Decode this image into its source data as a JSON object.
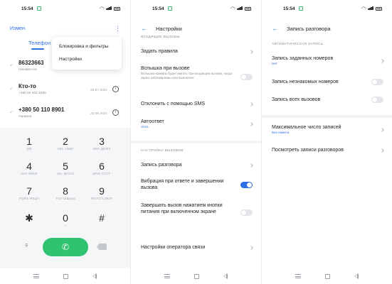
{
  "status": {
    "time": "15:54"
  },
  "dialer": {
    "edit_label": "Измен.",
    "more_icon": "⋮",
    "tab_label": "Телефон",
    "popup_menu": [
      "Блокировка и фильтры",
      "Настройки"
    ],
    "calls": [
      {
        "number": "86323663",
        "sub": "Неизвестно",
        "date": ""
      },
      {
        "number": "Кто-то",
        "sub": "+380 55 002 1565",
        "date": "25.07.2021"
      },
      {
        "number": "+380 50 110 8901",
        "sub": "Украина",
        "date": "22.06.2021"
      }
    ],
    "keys": [
      {
        "d": "1",
        "l": "QO"
      },
      {
        "d": "2",
        "l": "ABC АБВГ"
      },
      {
        "d": "3",
        "l": "DEF ДЕЖЗ"
      },
      {
        "d": "4",
        "l": "GHI ИЙКЛ"
      },
      {
        "d": "5",
        "l": "JKL МНОП"
      },
      {
        "d": "6",
        "l": "MNO РСТУ"
      },
      {
        "d": "7",
        "l": "PQRS ФХЦЧ"
      },
      {
        "d": "8",
        "l": "TUV ШЩЪЫ"
      },
      {
        "d": "9",
        "l": "WXYZ ЬЭЮЯ"
      },
      {
        "d": "✱",
        "l": ""
      },
      {
        "d": "0",
        "l": "+"
      },
      {
        "d": "#",
        "l": ""
      }
    ]
  },
  "settings": {
    "title": "Настройки",
    "section_incoming": "ВХОДЯЩИЕ ВЫЗОВЫ",
    "set_rules": "Задать правила",
    "flash_title": "Вспышка при вызове",
    "flash_sub": "Вспышка камеры будет мигать при входящем вызове, когда экран заблокирован или выключен",
    "sms_reject": "Отклонить с помощью SMS",
    "autoanswer_title": "Автоответ",
    "autoanswer_value": "Откл.",
    "section_calls": "НАСТРОЙКИ ВЫЗОВОВ",
    "call_recording": "Запись разговора",
    "vibration": "Вибрация при ответе и завершении вызова",
    "power_end": "Завершать вызов нажатием кнопки питания при включенном экране",
    "operator": "Настройки оператора связи"
  },
  "recording": {
    "title": "Запись разговора",
    "section_auto": "АВТОМАТИЧЕСКАЯ ЗАПИСЬ",
    "record_numbers_title": "Запись заданных номеров",
    "record_numbers_value": "Нет",
    "record_unknown": "Запись незнакомых номеров",
    "record_all": "Запись всех вызовов",
    "max_records_title": "Максимальное число записей",
    "max_records_value": "Без лимита",
    "view_records": "Посмотреть записи разговоров"
  }
}
